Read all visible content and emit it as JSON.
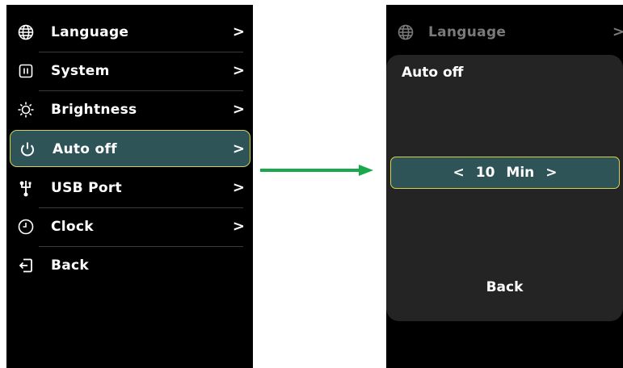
{
  "left_menu": {
    "items": [
      {
        "label": "Language",
        "chevron": ">",
        "icon": "globe-icon"
      },
      {
        "label": "System",
        "chevron": ">",
        "icon": "system-icon"
      },
      {
        "label": "Brightness",
        "chevron": ">",
        "icon": "sun-icon"
      },
      {
        "label": "Auto off",
        "chevron": ">",
        "icon": "power-icon",
        "selected": true
      },
      {
        "label": "USB Port",
        "chevron": ">",
        "icon": "usb-icon"
      },
      {
        "label": "Clock",
        "chevron": ">",
        "icon": "clock-icon"
      },
      {
        "label": "Back",
        "chevron": "",
        "icon": "exit-icon"
      }
    ]
  },
  "right_screen": {
    "header": {
      "label": "Language",
      "chevron": ">",
      "icon": "globe-icon"
    },
    "popup": {
      "title": "Auto off",
      "prev": "<",
      "value": "10",
      "unit": "Min",
      "next": ">",
      "back_label": "Back"
    }
  },
  "colors": {
    "screen_bg": "#000000",
    "selection_fill": "#2f5458",
    "selection_border": "#d7d24a",
    "popup_bg": "#242424",
    "arrow": "#1aa84c"
  }
}
